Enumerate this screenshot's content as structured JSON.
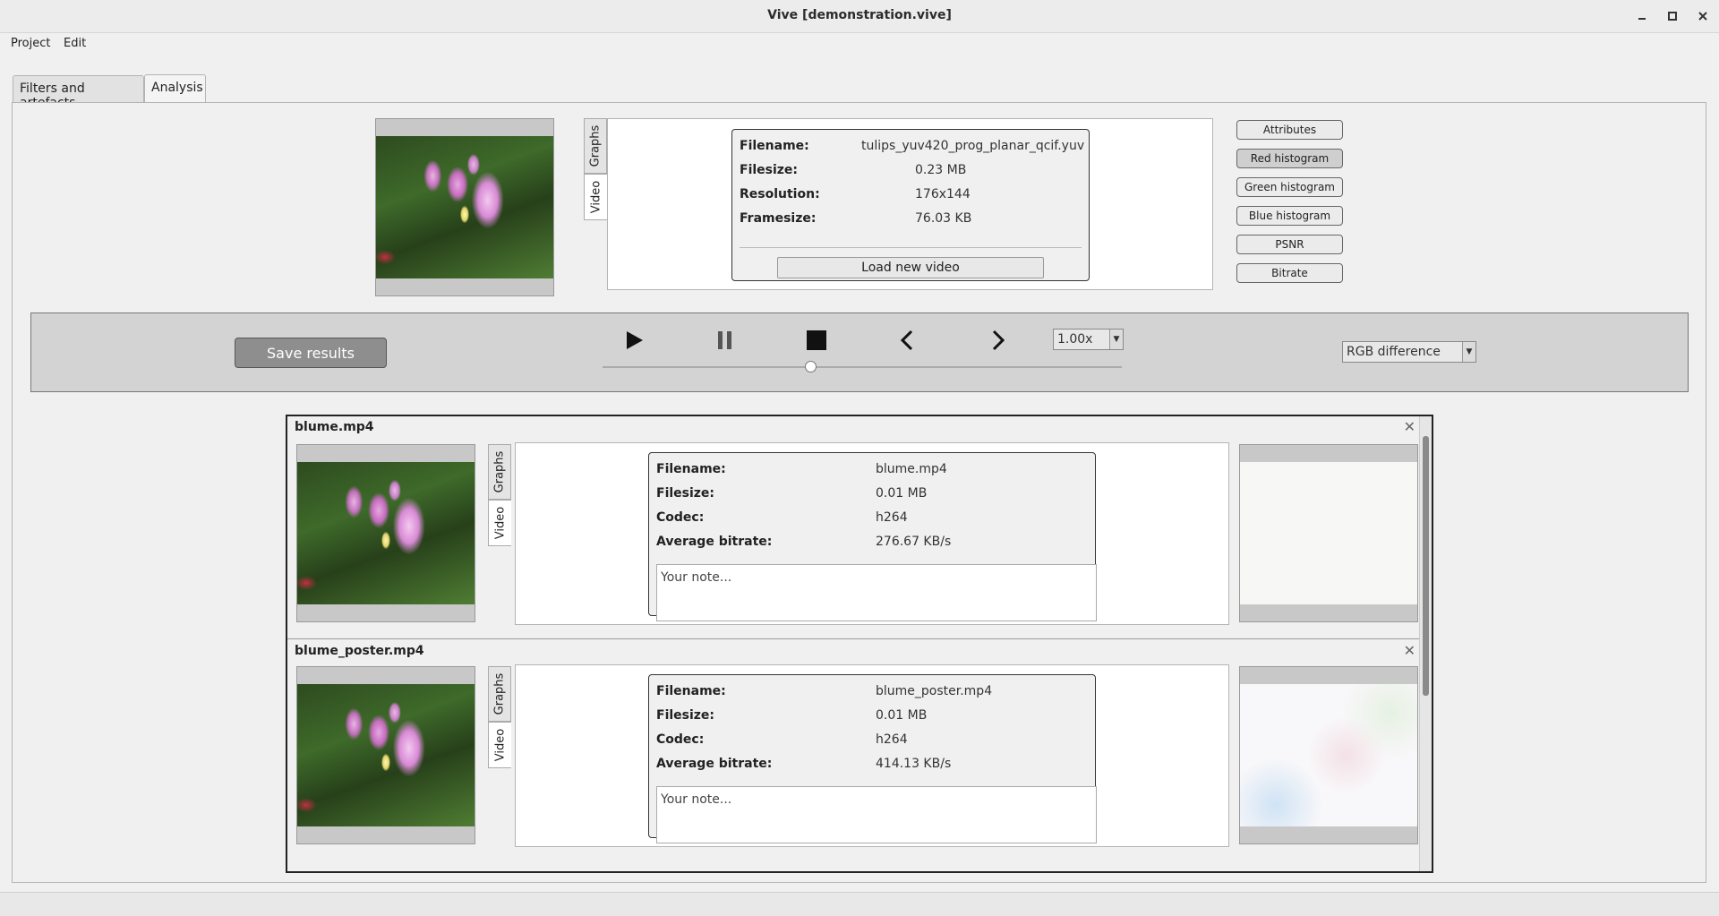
{
  "window": {
    "title": "Vive [demonstration.vive]"
  },
  "menu": {
    "items": [
      "Project",
      "Edit"
    ]
  },
  "tabs": [
    {
      "label": "Filters and artefacts"
    },
    {
      "label": "Analysis"
    }
  ],
  "source": {
    "vtabs": [
      "Graphs",
      "Video"
    ],
    "info": [
      {
        "key": "Filename:",
        "value": "tulips_yuv420_prog_planar_qcif.yuv"
      },
      {
        "key": "Filesize:",
        "value": "0.23 MB"
      },
      {
        "key": "Resolution:",
        "value": "176x144"
      },
      {
        "key": "Framesize:",
        "value": "76.03 KB"
      }
    ],
    "load_button": "Load new video"
  },
  "side_buttons": [
    "Attributes",
    "Red histogram",
    "Green histogram",
    "Blue histogram",
    "PSNR",
    "Bitrate"
  ],
  "playback": {
    "save_label": "Save results",
    "speed": "1.00x",
    "mode": "RGB difference",
    "progress": 0.4
  },
  "results": [
    {
      "title": "blume.mp4",
      "vtabs": [
        "Graphs",
        "Video"
      ],
      "info": [
        {
          "key": "Filename:",
          "value": "blume.mp4"
        },
        {
          "key": "Filesize:",
          "value": "0.01 MB"
        },
        {
          "key": "Codec:",
          "value": "h264"
        },
        {
          "key": "Average bitrate:",
          "value": "276.67 KB/s"
        }
      ],
      "note_placeholder": "Your note...",
      "close": "✕"
    },
    {
      "title": "blume_poster.mp4",
      "vtabs": [
        "Graphs",
        "Video"
      ],
      "info": [
        {
          "key": "Filename:",
          "value": "blume_poster.mp4"
        },
        {
          "key": "Filesize:",
          "value": "0.01 MB"
        },
        {
          "key": "Codec:",
          "value": "h264"
        },
        {
          "key": "Average bitrate:",
          "value": "414.13 KB/s"
        }
      ],
      "note_placeholder": "Your note...",
      "close": "✕"
    }
  ],
  "icons": {
    "minimize": "minimize-icon",
    "maximize": "maximize-icon",
    "close": "close-icon",
    "play": "play-icon",
    "pause": "pause-icon",
    "stop": "stop-icon",
    "prev": "chevron-left-icon",
    "next": "chevron-right-icon"
  }
}
